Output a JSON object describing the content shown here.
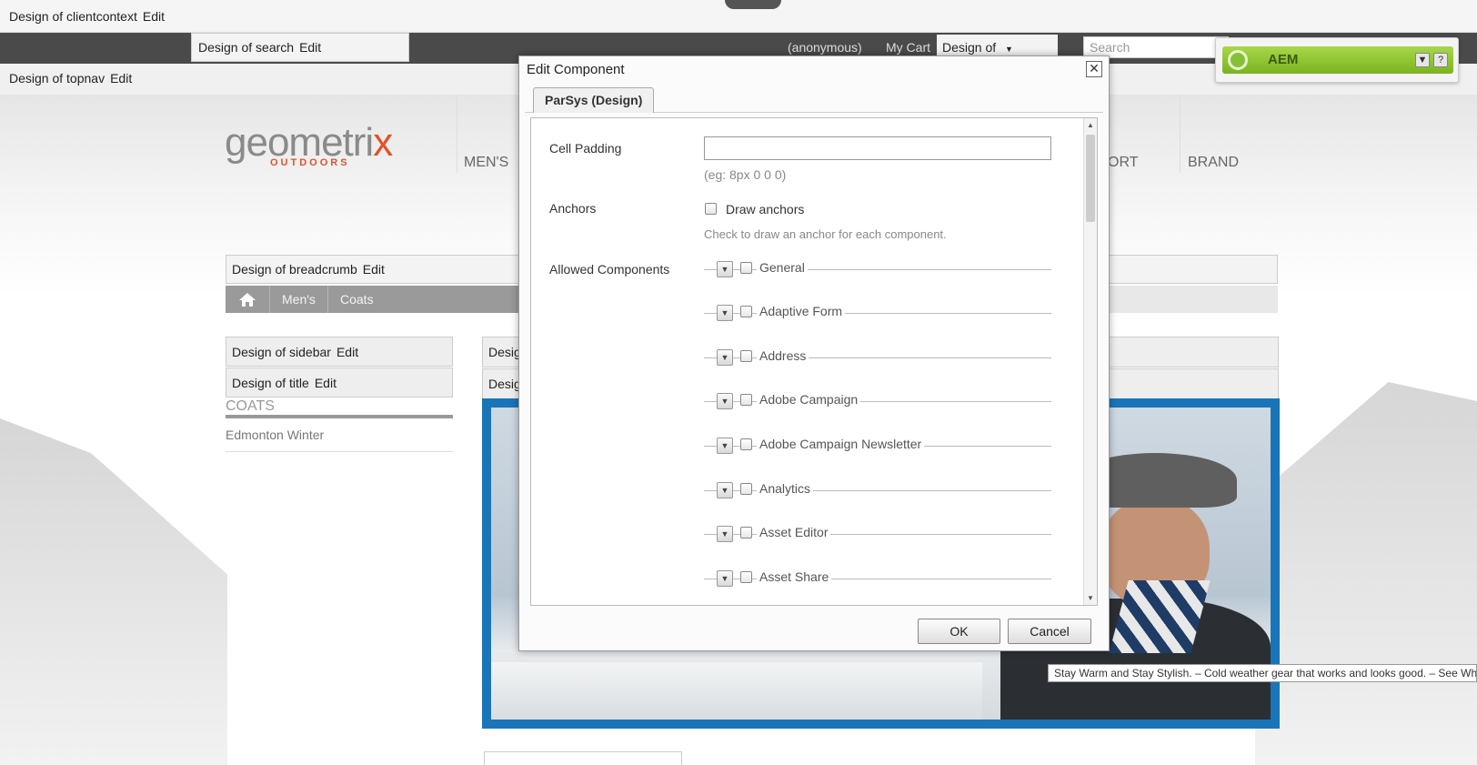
{
  "design_bars": {
    "clientcontext": "Design of clientcontext",
    "search": "Design of search",
    "topnav": "Design of topnav",
    "breadcrumb": "Design of breadcrumb",
    "sidebar": "Design of sidebar",
    "title": "Design of title",
    "main_1": "Design",
    "main_2": "Design",
    "edit": "Edit"
  },
  "header": {
    "user": "(anonymous)",
    "cart": "My Cart",
    "design_of": "Design of",
    "search_placeholder": "Search"
  },
  "logo": {
    "main_a": "geometri",
    "main_x": "x",
    "sub": "OUTDOORS"
  },
  "nav": [
    "MEN'S",
    "ORT",
    "BRAND"
  ],
  "breadcrumb": [
    "Men's",
    "Coats"
  ],
  "sidebar": {
    "title": "COATS",
    "item": "Edmonton Winter"
  },
  "tooltip": "Stay Warm and Stay Stylish. – Cold weather gear that works and looks good. – See What'",
  "aem": {
    "label": "AEM",
    "help": "?"
  },
  "dialog": {
    "title": "Edit Component",
    "close": "✕",
    "tab": "ParSys (Design)",
    "cell_padding_label": "Cell Padding",
    "cell_padding_value": "",
    "cell_padding_hint": "(eg: 8px 0 0 0)",
    "anchors_label": "Anchors",
    "draw_anchors": "Draw anchors",
    "anchors_hint": "Check to draw an anchor for each component.",
    "allowed_label": "Allowed Components",
    "components": [
      "General",
      "Adaptive Form",
      "Address",
      "Adobe Campaign",
      "Adobe Campaign Newsletter",
      "Analytics",
      "Asset Editor",
      "Asset Share"
    ],
    "ok": "OK",
    "cancel": "Cancel"
  },
  "colors": {
    "accent_blue": "#1a75b8",
    "logo_orange": "#e0522a",
    "aem_green": "#7bb31f"
  },
  "icons": {
    "home": "home-icon",
    "close": "close-icon",
    "dropdown": "chevron-down-icon",
    "aem": "aem-logo-icon"
  }
}
